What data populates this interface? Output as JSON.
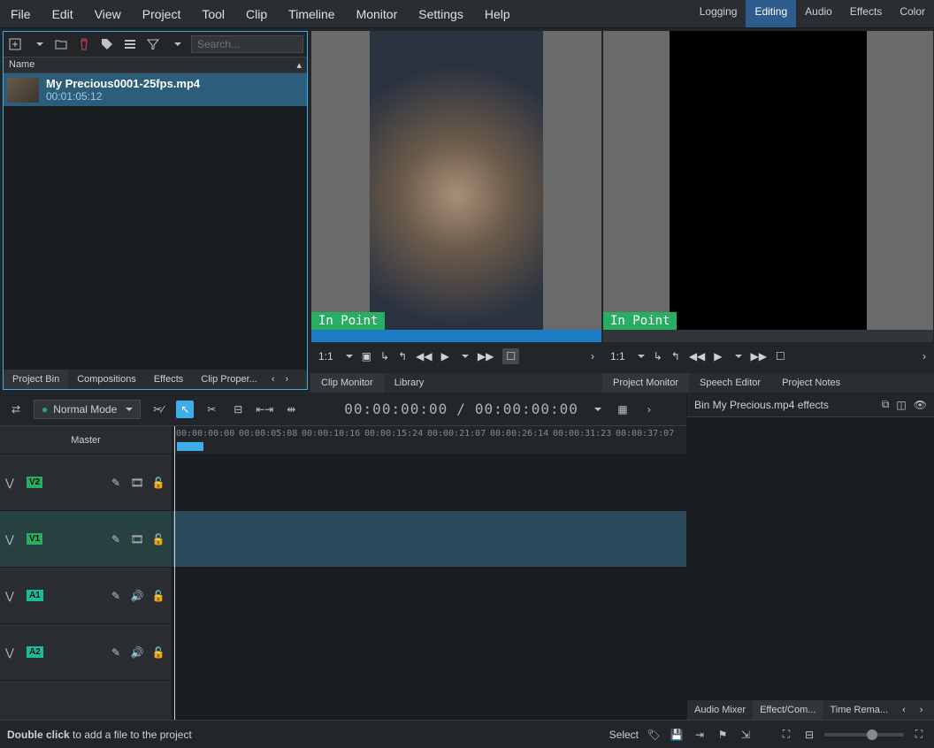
{
  "menus": [
    "File",
    "Edit",
    "View",
    "Project",
    "Tool",
    "Clip",
    "Timeline",
    "Monitor",
    "Settings",
    "Help"
  ],
  "workspaces": {
    "items": [
      "Logging",
      "Editing",
      "Audio",
      "Effects",
      "Color"
    ],
    "active": "Editing"
  },
  "bin": {
    "search_placeholder": "Search...",
    "header_name": "Name",
    "items": [
      {
        "title": "My Precious0001-25fps.mp4",
        "duration": "00:01:05:12"
      }
    ],
    "tabs": [
      "Project Bin",
      "Compositions",
      "Effects",
      "Clip Proper..."
    ],
    "active_tab": "Project Bin"
  },
  "clip_monitor": {
    "in_point": "In Point",
    "zoom": "1:1",
    "tabs": [
      "Clip Monitor",
      "Library"
    ],
    "active_tab": "Clip Monitor"
  },
  "project_monitor": {
    "in_point": "In Point",
    "zoom": "1:1",
    "tabs": [
      "Project Monitor",
      "Speech Editor",
      "Project Notes"
    ],
    "active_tab": "Project Monitor"
  },
  "timeline": {
    "mode": "Normal Mode",
    "tc_left": "00:00:00:00",
    "tc_sep": "/",
    "tc_right": "00:00:00:00",
    "master": "Master",
    "ticks": [
      "00:00:00:00",
      "00:00:05:08",
      "00:00:10:16",
      "00:00:15:24",
      "00:00:21:07",
      "00:00:26:14",
      "00:00:31:23",
      "00:00:37:07"
    ],
    "tracks": [
      {
        "id": "V2",
        "kind": "v"
      },
      {
        "id": "V1",
        "kind": "v",
        "highlight": true
      },
      {
        "id": "A1",
        "kind": "a"
      },
      {
        "id": "A2",
        "kind": "a"
      }
    ]
  },
  "effects": {
    "title": "Bin My Precious.mp4 effects",
    "tabs": [
      "Audio Mixer",
      "Effect/Com...",
      "Time Rema..."
    ],
    "active_tab": "Effect/Com..."
  },
  "status": {
    "hint_bold": "Double click",
    "hint_rest": " to add a file to the project",
    "select": "Select"
  }
}
